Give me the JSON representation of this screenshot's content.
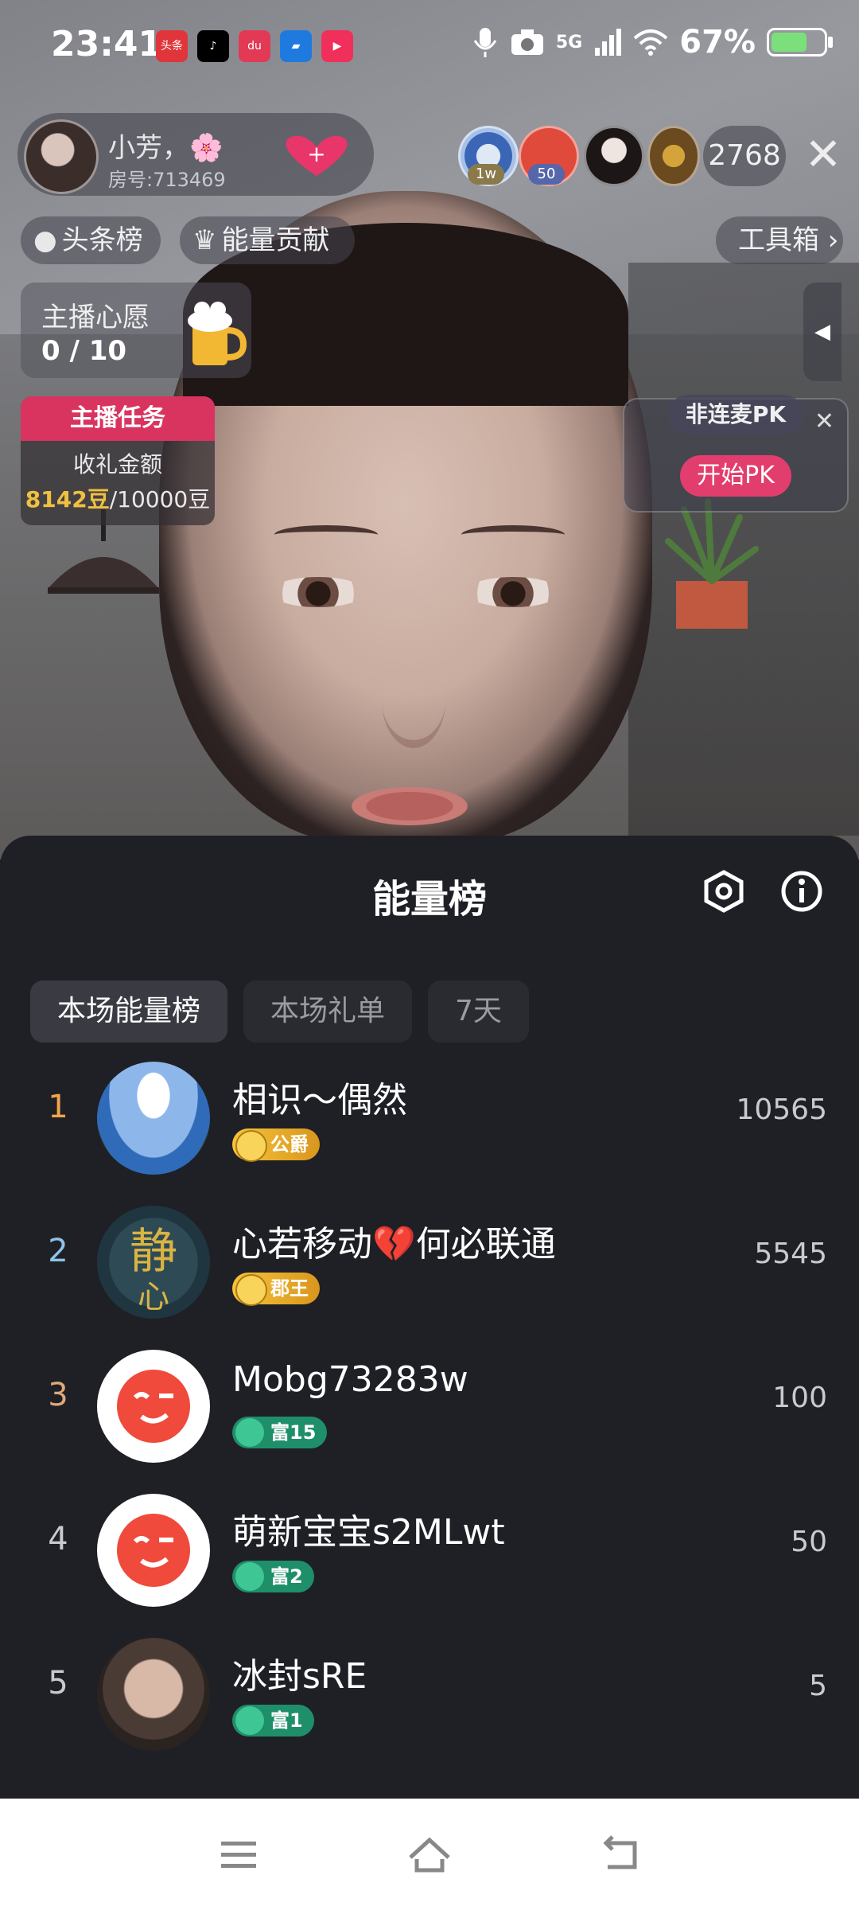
{
  "status_bar": {
    "time": "23:41",
    "app_icons": [
      {
        "name": "toutiao-icon",
        "text": "头条",
        "color": "#e0353a"
      },
      {
        "name": "tiktok-icon",
        "text": "",
        "color": "#000000"
      },
      {
        "name": "dewu-icon",
        "text": "du",
        "color": "#e23a55"
      },
      {
        "name": "bookmark-app-icon",
        "text": "",
        "color": "#1f7ae0"
      },
      {
        "name": "video-app-icon",
        "text": "",
        "color": "#f0305a"
      }
    ],
    "network": "5G",
    "battery": "67%"
  },
  "host": {
    "name": "小芳，🌸",
    "room": "房号:713469"
  },
  "viewers": {
    "badges": [
      "1w",
      "50"
    ],
    "count": "2768"
  },
  "chips": {
    "headline": "头条榜",
    "energy": "能量贡献",
    "toolbox": "工具箱 ›"
  },
  "wish": {
    "title": "主播心愿",
    "progress": "0 / 10",
    "progress_value": 0
  },
  "task": {
    "title": "主播任务",
    "label": "收礼金额",
    "current": "8142豆",
    "target": "/10000豆"
  },
  "pk": {
    "label": "非连麦PK",
    "button": "开始PK"
  },
  "sheet": {
    "title": "能量榜",
    "tabs": [
      "本场能量榜",
      "本场礼单",
      "7天"
    ],
    "active_tab": 0
  },
  "leaderboard": [
    {
      "rank": "1",
      "name": "相识～偶然",
      "level": "公爵",
      "score": "10565",
      "rank_color": "#f2a54a",
      "level_style": "gold"
    },
    {
      "rank": "2",
      "name": "心若移动💔何必联通",
      "level": "郡王",
      "score": "5545",
      "rank_color": "#8fc4e8",
      "level_style": "gold"
    },
    {
      "rank": "3",
      "name": "Mobg73283w",
      "level": "富15",
      "score": "100",
      "rank_color": "#e0a87a",
      "level_style": "teal"
    },
    {
      "rank": "4",
      "name": "萌新宝宝s2MLwt",
      "level": "富2",
      "score": "50",
      "rank_color": "#c9c9d0",
      "level_style": "teal"
    },
    {
      "rank": "5",
      "name": "冰封sRE",
      "level": "富1",
      "score": "5",
      "rank_color": "#c9c9d0",
      "level_style": "teal"
    }
  ],
  "colors": {
    "accent_pink": "#e23e6d",
    "gold": "#f0c040",
    "sheet_bg": "#1f2026"
  }
}
